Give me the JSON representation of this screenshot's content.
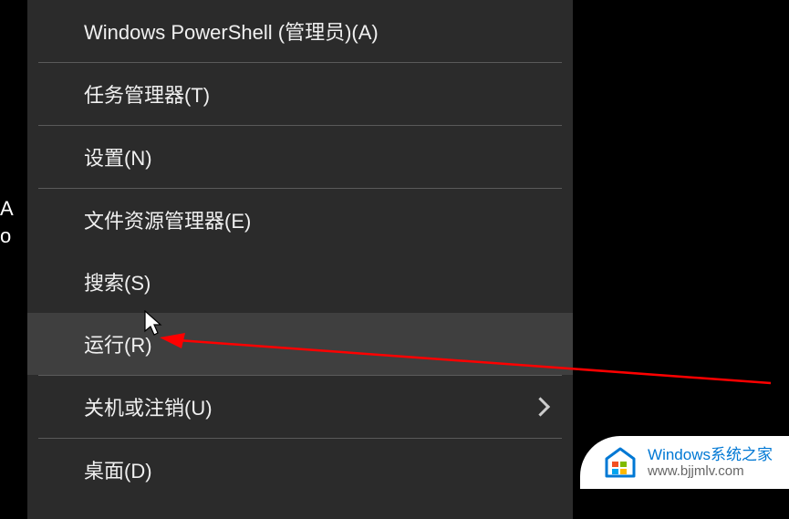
{
  "left_fragment": {
    "line1": "A",
    "line2": "o"
  },
  "menu": {
    "items": [
      {
        "label": "Windows PowerShell (管理员)(A)",
        "hover": false,
        "submenu": false
      },
      {
        "separator": true
      },
      {
        "label": "任务管理器(T)",
        "hover": false,
        "submenu": false
      },
      {
        "separator": true
      },
      {
        "label": "设置(N)",
        "hover": false,
        "submenu": false
      },
      {
        "separator": true
      },
      {
        "label": "文件资源管理器(E)",
        "hover": false,
        "submenu": false
      },
      {
        "label": "搜索(S)",
        "hover": false,
        "submenu": false
      },
      {
        "label": "运行(R)",
        "hover": true,
        "submenu": false
      },
      {
        "separator": true
      },
      {
        "label": "关机或注销(U)",
        "hover": false,
        "submenu": true
      },
      {
        "separator": true
      },
      {
        "label": "桌面(D)",
        "hover": false,
        "submenu": false
      }
    ]
  },
  "watermark": {
    "title": "Windows系统之家",
    "url": "www.bjjmlv.com"
  }
}
